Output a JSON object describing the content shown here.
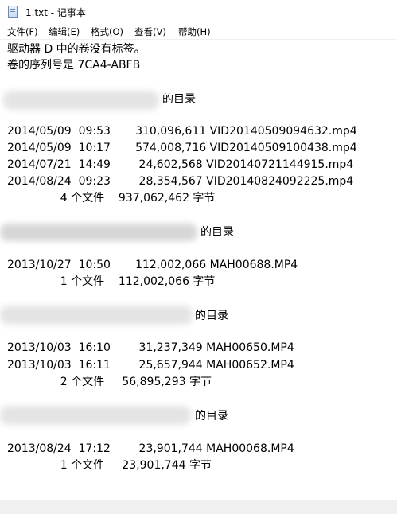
{
  "window": {
    "title": "1.txt - 记事本"
  },
  "menu": [
    "文件(F)",
    "编辑(E)",
    "格式(O)",
    "查看(V)",
    "帮助(H)"
  ],
  "text": {
    "vol1": "驱动器 D 中的卷没有标签。",
    "vol2": "卷的序列号是 7CA4-ABFB",
    "dir_suffix": "的目录",
    "b1r1": "2014/05/09  09:53       310,096,611 VID20140509094632.mp4",
    "b1r2": "2014/05/09  10:17       574,008,716 VID20140509100438.mp4",
    "b1r3": "2014/07/21  14:49        24,602,568 VID20140721144915.mp4",
    "b1r4": "2014/08/24  09:23        28,354,567 VID20140824092225.mp4",
    "b1sum": "               4 个文件    937,062,462 字节",
    "b2r1": "2013/10/27  10:50       112,002,066 MAH00688.MP4",
    "b2sum": "               1 个文件    112,002,066 字节",
    "b3r1": "2013/10/03  16:10        31,237,349 MAH00650.MP4",
    "b3r2": "2013/10/03  16:11        25,657,944 MAH00652.MP4",
    "b3sum": "               2 个文件     56,895,293 字节",
    "b4r1": "2013/08/24  17:12        23,901,744 MAH00068.MP4",
    "b4sum": "               1 个文件     23,901,744 字节"
  }
}
